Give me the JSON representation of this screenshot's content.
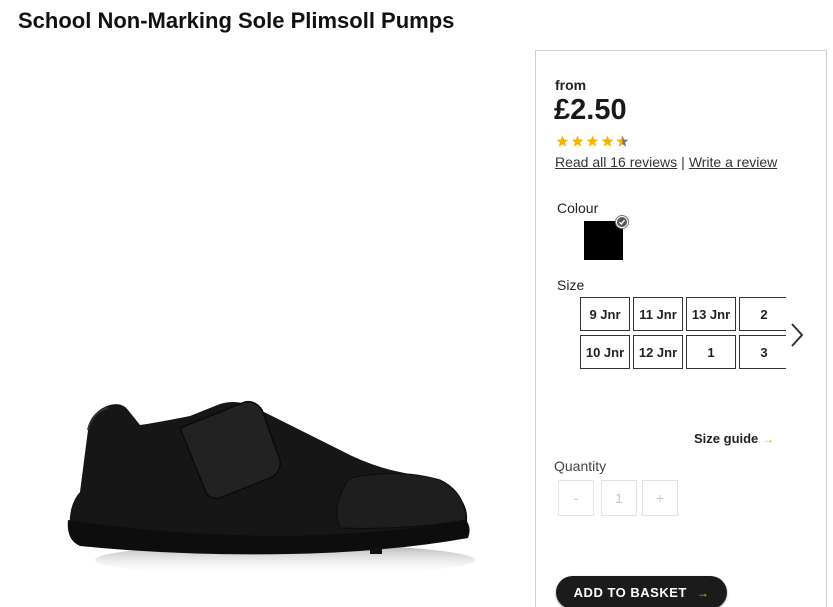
{
  "product": {
    "title": "School Non-Marking Sole Plimsoll Pumps",
    "image_icon": "black-plimsoll-shoe-image"
  },
  "pricing": {
    "from_label": "from",
    "price": "£2.50"
  },
  "rating": {
    "stars": 4.5,
    "max": 5,
    "star_color": "#f5b400",
    "read_reviews_label": "Read all 16 reviews",
    "separator": "|",
    "write_review_label": "Write a review"
  },
  "colour": {
    "label": "Colour",
    "selected_color": "#000000"
  },
  "size": {
    "label": "Size",
    "options": [
      "9 Jnr",
      "11 Jnr",
      "13 Jnr",
      "2",
      "10 Jnr",
      "12 Jnr",
      "1",
      "3"
    ],
    "next_icon": "chevron-right-icon"
  },
  "size_guide": {
    "label": "Size guide",
    "arrow": "→"
  },
  "quantity": {
    "label": "Quantity",
    "minus": "-",
    "value": "1",
    "plus": "+"
  },
  "basket": {
    "label": "ADD TO BASKET",
    "arrow": "→",
    "button_color": "#1b1b1b",
    "accent_color": "#f5c400"
  }
}
